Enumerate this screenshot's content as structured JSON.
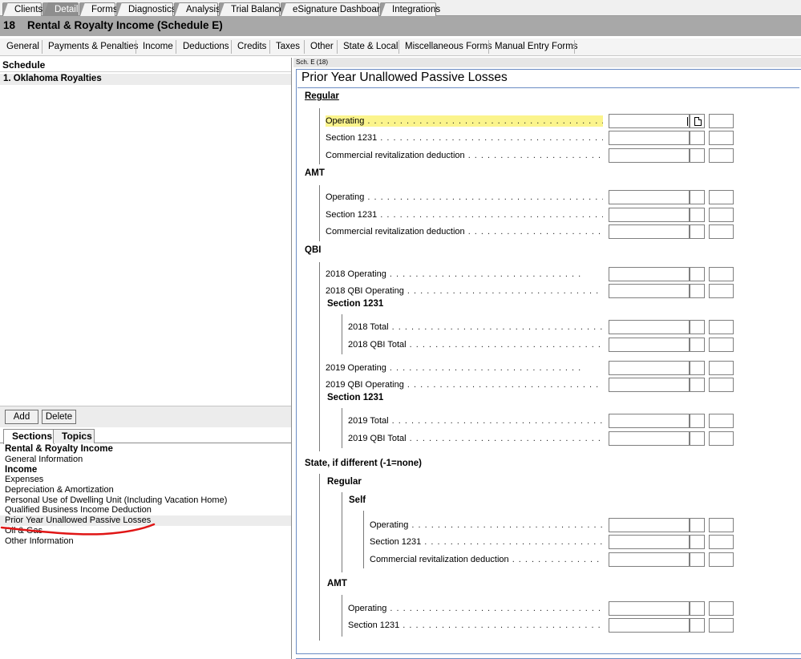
{
  "top_tabs": [
    {
      "label": "Clients",
      "active": false
    },
    {
      "label": "Detail",
      "active": true
    },
    {
      "label": "Forms",
      "active": false
    },
    {
      "label": "Diagnostics",
      "active": false
    },
    {
      "label": "Analysis",
      "active": false
    },
    {
      "label": "Trial Balance",
      "active": false
    },
    {
      "label": "eSignature Dashboard",
      "active": false
    },
    {
      "label": "Integrations",
      "active": false
    }
  ],
  "title_bar": {
    "number": "18",
    "title": "Rental & Royalty Income (Schedule E)"
  },
  "section_menu": [
    "General",
    "Payments & Penalties",
    "Income",
    "Deductions",
    "Credits",
    "Taxes",
    "Other",
    "State & Local",
    "Miscellaneous Forms",
    "Manual Entry Forms"
  ],
  "schedule": {
    "header": "Schedule",
    "items": [
      "1. Oklahoma Royalties"
    ]
  },
  "buttons": {
    "add": "Add",
    "delete": "Delete"
  },
  "lower_tabs": [
    {
      "label": "Sections",
      "active": true
    },
    {
      "label": "Topics",
      "active": false
    }
  ],
  "sections": [
    {
      "label": "Rental & Royalty Income",
      "bold": true,
      "selected": false
    },
    {
      "label": "General Information",
      "bold": false,
      "selected": false
    },
    {
      "label": "Income",
      "bold": true,
      "selected": false
    },
    {
      "label": "Expenses",
      "bold": false,
      "selected": false
    },
    {
      "label": "Depreciation & Amortization",
      "bold": false,
      "selected": false
    },
    {
      "label": "Personal Use of Dwelling Unit (Including Vacation Home)",
      "bold": false,
      "selected": false
    },
    {
      "label": "Qualified Business Income Deduction",
      "bold": false,
      "selected": false
    },
    {
      "label": "Prior Year Unallowed Passive Losses",
      "bold": false,
      "selected": true
    },
    {
      "label": "Oil & Gas",
      "bold": false,
      "selected": false
    },
    {
      "label": "Other Information",
      "bold": false,
      "selected": false
    }
  ],
  "form": {
    "tag": "Sch. E (18)",
    "title": "Prior Year Unallowed Passive Losses",
    "headings": {
      "regular": "Regular",
      "amt": "AMT",
      "qbi": "QBI",
      "section1231_a": "Section 1231",
      "section1231_b": "Section 1231",
      "state": "State, if different (-1=none)",
      "state_regular": "Regular",
      "self": "Self",
      "state_amt": "AMT"
    },
    "rows": {
      "reg_operating": "Operating",
      "reg_sec1231": "Section 1231",
      "reg_crd": "Commercial revitalization deduction",
      "amt_operating": "Operating",
      "amt_sec1231": "Section 1231",
      "amt_crd": "Commercial revitalization deduction",
      "qbi_2018_op": "2018 Operating",
      "qbi_2018_qbi_op": "2018 QBI Operating",
      "qbi_2018_total": "2018 Total",
      "qbi_2018_qbi_total": "2018 QBI Total",
      "qbi_2019_op": "2019 Operating",
      "qbi_2019_qbi_op": "2019 QBI Operating",
      "qbi_2019_total": "2019 Total",
      "qbi_2019_qbi_total": "2019 QBI Total",
      "st_self_operating": "Operating",
      "st_self_sec1231": "Section 1231",
      "st_self_crd": "Commercial revitalization deduction",
      "st_amt_operating": "Operating",
      "st_amt_sec1231": "Section 1231"
    }
  },
  "colors": {
    "highlight": "#fbf48c",
    "frame_blue": "#6b8cc4",
    "red_annotation": "#e01515",
    "title_bar": "#a8a8a8"
  }
}
